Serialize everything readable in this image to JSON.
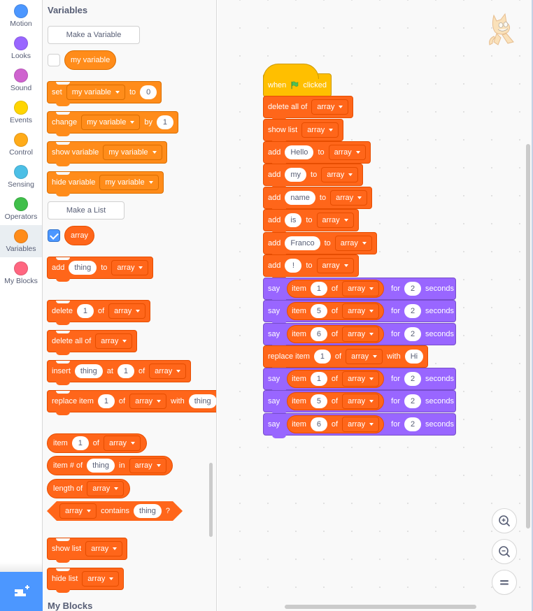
{
  "categories": [
    {
      "label": "Motion",
      "color": "#4c97ff"
    },
    {
      "label": "Looks",
      "color": "#9966ff"
    },
    {
      "label": "Sound",
      "color": "#cf63cf"
    },
    {
      "label": "Events",
      "color": "#ffd500"
    },
    {
      "label": "Control",
      "color": "#ffab19"
    },
    {
      "label": "Sensing",
      "color": "#4cbfe6"
    },
    {
      "label": "Operators",
      "color": "#40bf4a"
    },
    {
      "label": "Variables",
      "color": "#ff8c1a",
      "selected": true
    },
    {
      "label": "My Blocks",
      "color": "#ff6680"
    }
  ],
  "palette": {
    "title": "Variables",
    "make_variable": "Make a Variable",
    "variable_reporter": "my variable",
    "variable_checked": false,
    "set": {
      "label": "set",
      "var": "my variable",
      "to": "to",
      "value": "0"
    },
    "change": {
      "label": "change",
      "var": "my variable",
      "by": "by",
      "value": "1"
    },
    "show_variable": {
      "label": "show variable",
      "var": "my variable"
    },
    "hide_variable": {
      "label": "hide variable",
      "var": "my variable"
    },
    "make_list": "Make a List",
    "list_reporter": "array",
    "list_checked": true,
    "add": {
      "label": "add",
      "value": "thing",
      "to": "to",
      "list": "array"
    },
    "delete": {
      "label": "delete",
      "value": "1",
      "of": "of",
      "list": "array"
    },
    "delete_all": {
      "label": "delete all of",
      "list": "array"
    },
    "insert": {
      "label": "insert",
      "value": "thing",
      "at": "at",
      "index": "1",
      "of": "of",
      "list": "array"
    },
    "replace": {
      "label": "replace item",
      "index": "1",
      "of": "of",
      "list": "array",
      "with": "with",
      "value": "thing"
    },
    "item": {
      "label": "item",
      "index": "1",
      "of": "of",
      "list": "array"
    },
    "item_num": {
      "label": "item # of",
      "value": "thing",
      "in": "in",
      "list": "array"
    },
    "length": {
      "label": "length of",
      "list": "array"
    },
    "contains": {
      "list": "array",
      "label": "contains",
      "value": "thing",
      "q": "?"
    },
    "show_list": {
      "label": "show list",
      "list": "array"
    },
    "hide_list": {
      "label": "hide list",
      "list": "array"
    },
    "next_title": "My Blocks"
  },
  "script": {
    "hat": {
      "when": "when",
      "clicked": "clicked"
    },
    "delete_all": {
      "label": "delete all of",
      "list": "array"
    },
    "show_list": {
      "label": "show list",
      "list": "array"
    },
    "adds": [
      {
        "label": "add",
        "value": "Hello",
        "to": "to",
        "list": "array"
      },
      {
        "label": "add",
        "value": "my",
        "to": "to",
        "list": "array"
      },
      {
        "label": "add",
        "value": "name",
        "to": "to",
        "list": "array"
      },
      {
        "label": "add",
        "value": "is",
        "to": "to",
        "list": "array"
      },
      {
        "label": "add",
        "value": "Franco",
        "to": "to",
        "list": "array"
      },
      {
        "label": "add",
        "value": "!",
        "to": "to",
        "list": "array"
      }
    ],
    "says1": [
      {
        "say": "say",
        "item": "item",
        "index": "1",
        "of": "of",
        "list": "array",
        "for": "for",
        "secs": "2",
        "seconds": "seconds"
      },
      {
        "say": "say",
        "item": "item",
        "index": "5",
        "of": "of",
        "list": "array",
        "for": "for",
        "secs": "2",
        "seconds": "seconds"
      },
      {
        "say": "say",
        "item": "item",
        "index": "6",
        "of": "of",
        "list": "array",
        "for": "for",
        "secs": "2",
        "seconds": "seconds"
      }
    ],
    "replace": {
      "label": "replace item",
      "index": "1",
      "of": "of",
      "list": "array",
      "with": "with",
      "value": "Hi"
    },
    "says2": [
      {
        "say": "say",
        "item": "item",
        "index": "1",
        "of": "of",
        "list": "array",
        "for": "for",
        "secs": "2",
        "seconds": "seconds"
      },
      {
        "say": "say",
        "item": "item",
        "index": "5",
        "of": "of",
        "list": "array",
        "for": "for",
        "secs": "2",
        "seconds": "seconds"
      },
      {
        "say": "say",
        "item": "item",
        "index": "6",
        "of": "of",
        "list": "array",
        "for": "for",
        "secs": "2",
        "seconds": "seconds"
      }
    ]
  },
  "workspace_controls": [
    "zoom-in",
    "zoom-out",
    "reset-zoom"
  ]
}
